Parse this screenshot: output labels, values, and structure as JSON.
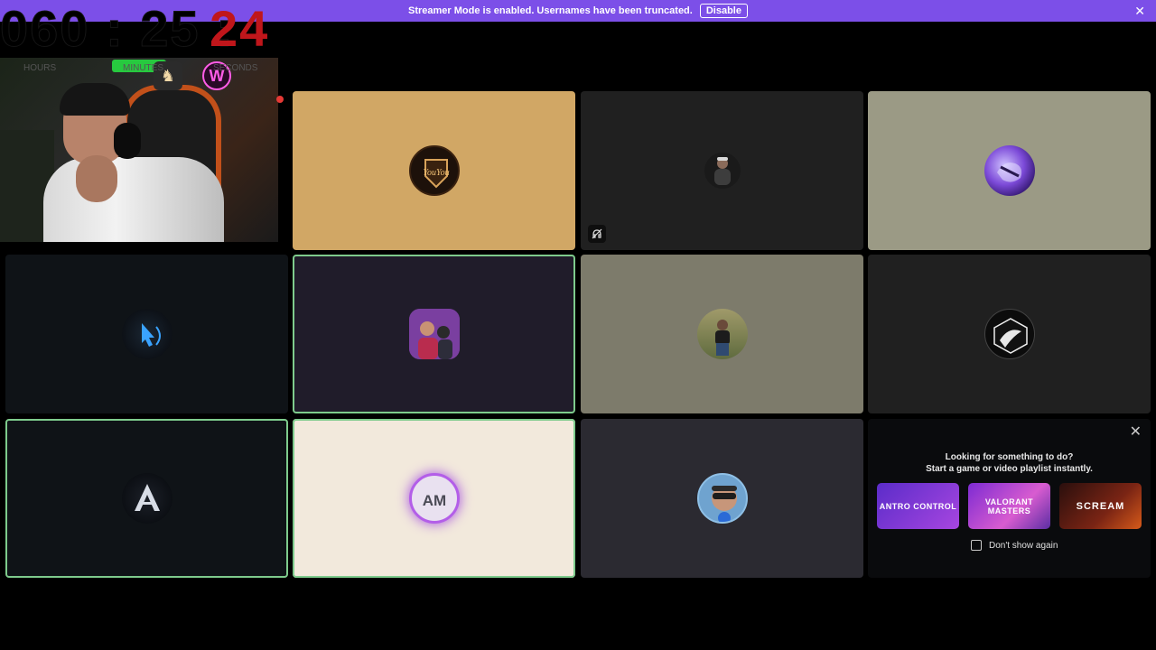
{
  "banner": {
    "message": "Streamer Mode is enabled. Usernames have been truncated.",
    "button_label": "Disable",
    "close_icon": "close-icon",
    "color": "#7c4fe8"
  },
  "timer": {
    "hours": "060",
    "minutes": "25",
    "separator": ":",
    "seconds": "24",
    "labels": [
      "HOURS",
      "MINUTES",
      "SECONDS"
    ]
  },
  "tiles": [
    {
      "name": "tile-youyou",
      "bg": "#d1a765",
      "avatar": "youyou-logo",
      "text": "YouYou",
      "selected": false
    },
    {
      "name": "tile-2",
      "bg": "#202020",
      "avatar": "person-photo",
      "selected": false,
      "muted_icon": "deafened-icon"
    },
    {
      "name": "tile-3",
      "bg": "#9b9a85",
      "avatar": "purple-art",
      "selected": false
    },
    {
      "name": "tile-4",
      "bg": "#0f1317",
      "avatar": "blue-cursor-logo",
      "selected": false
    },
    {
      "name": "tile-5",
      "bg": "#201c2a",
      "avatar": "footballer-photo",
      "selected": true
    },
    {
      "name": "tile-6",
      "bg": "#7d7b6b",
      "avatar": "person-outdoor",
      "selected": false
    },
    {
      "name": "tile-7",
      "bg": "#202020",
      "avatar": "black-art",
      "selected": false
    },
    {
      "name": "tile-8",
      "bg": "#0f1317",
      "avatar": "a-logo",
      "selected": true
    },
    {
      "name": "tile-9",
      "bg": "#f2e9dc",
      "avatar": "am-logo",
      "text": "AM",
      "selected": true
    },
    {
      "name": "tile-10",
      "bg": "#2b2a31",
      "avatar": "man-sunglasses",
      "selected": false
    }
  ],
  "activity": {
    "line1": "Looking for something to do?",
    "line2": "Start a game or video playlist instantly.",
    "cards": [
      {
        "title": "ANTRO CONTROL",
        "name": "activity-card-antro-control"
      },
      {
        "title": "VALORANT MASTERS",
        "name": "activity-card-valorant-masters"
      },
      {
        "title": "SCREAM",
        "name": "activity-card-scream"
      }
    ],
    "dont_show_label": "Don't show again",
    "close_icon": "close-icon"
  }
}
